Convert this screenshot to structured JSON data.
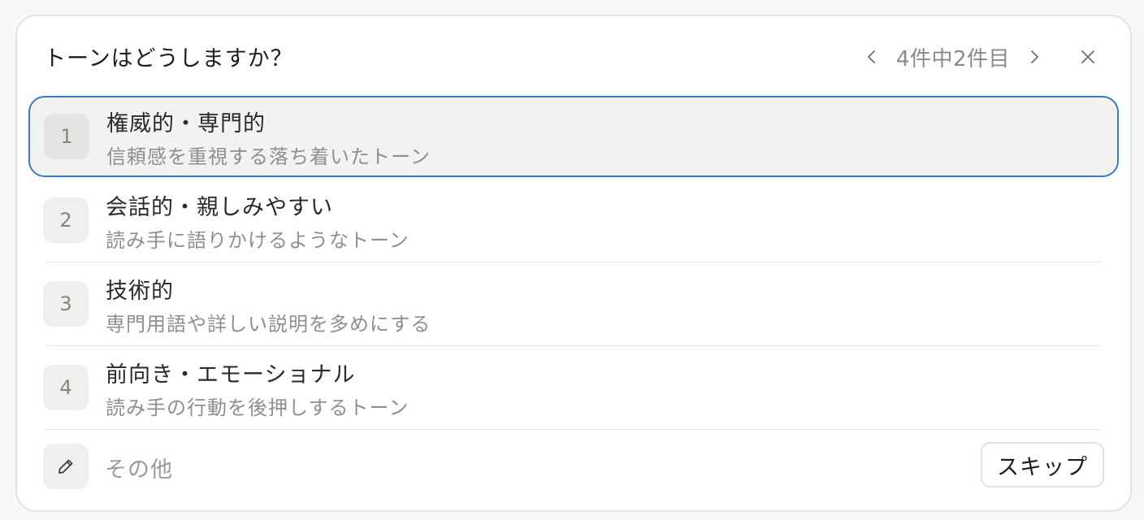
{
  "dialog": {
    "question": "トーンはどうしますか？",
    "pager": {
      "counter": "4件中2件目",
      "prev_icon": "chevron-left-icon",
      "next_icon": "chevron-right-icon",
      "close_icon": "close-icon"
    }
  },
  "options": [
    {
      "number": "1",
      "label": "権威的・専門的",
      "description": "信頼感を重視する落ち着いたトーン",
      "selected": true
    },
    {
      "number": "2",
      "label": "会話的・親しみやすい",
      "description": "読み手に語りかけるようなトーン",
      "selected": false
    },
    {
      "number": "3",
      "label": "技術的",
      "description": "専門用語や詳しい説明を多めにする",
      "selected": false
    },
    {
      "number": "4",
      "label": "前向き・エモーショナル",
      "description": "読み手の行動を後押しするトーン",
      "selected": false
    }
  ],
  "footer": {
    "other_icon": "pencil-icon",
    "other_label": "その他",
    "skip_label": "スキップ"
  },
  "colors": {
    "selected_border": "#3a79c9",
    "selected_bg": "#f2f2f1"
  }
}
